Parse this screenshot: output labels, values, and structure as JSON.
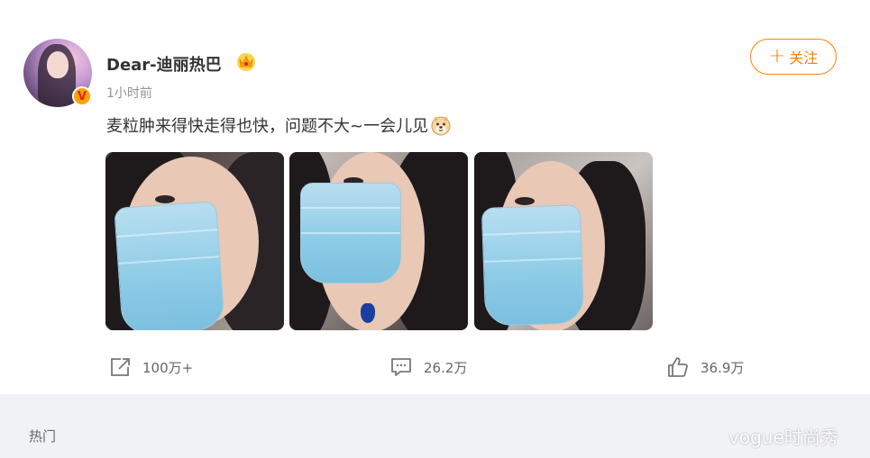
{
  "post": {
    "username": "Dear-迪丽热巴",
    "verified_badge": "V",
    "timestamp": "1小时前",
    "text": "麦粒肿来得快走得也快，问题不大~一会儿见",
    "follow_label": "关注",
    "follow_icon": "plus-icon",
    "emoji": "doge-emoji",
    "images": [
      "photo-1",
      "photo-2",
      "photo-3"
    ]
  },
  "actions": {
    "repost": {
      "icon": "share-icon",
      "count": "100万+"
    },
    "comment": {
      "icon": "comment-icon",
      "count": "26.2万"
    },
    "like": {
      "icon": "thumbs-up-icon",
      "count": "36.9万"
    }
  },
  "bottom": {
    "tab_label": "热门"
  },
  "watermark": "vogue时尚秀",
  "colors": {
    "accent": "#ff8200",
    "badge": "#f7a400",
    "text": "#333333",
    "muted": "#939393",
    "page_bg": "#f1f2f5"
  }
}
